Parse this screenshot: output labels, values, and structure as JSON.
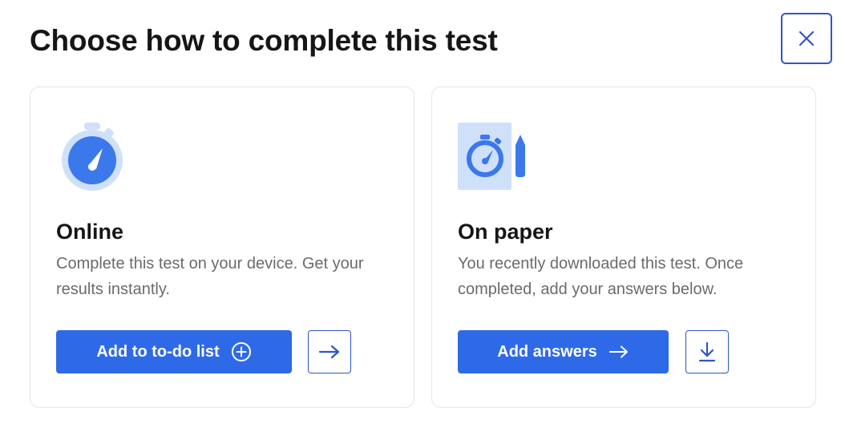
{
  "modal": {
    "title": "Choose how to complete this test",
    "close_icon": "close-icon"
  },
  "options": {
    "online": {
      "title": "Online",
      "description": "Complete this test on your device. Get your results instantly.",
      "primary_label": "Add to to-do list",
      "primary_icon": "plus-circle-icon",
      "secondary_icon": "arrow-right-icon",
      "illustration_icon": "stopwatch-icon"
    },
    "paper": {
      "title": "On paper",
      "description": "You recently downloaded this test. Once completed, add your answers below.",
      "primary_label": "Add answers",
      "primary_icon": "arrow-right-icon",
      "secondary_icon": "download-icon",
      "illustration_icon": "stopwatch-pencil-icon"
    }
  },
  "colors": {
    "accent": "#2e6ae8",
    "outline": "#2f55c8",
    "illustration_light": "#cfe0fb",
    "text_muted": "#6b6b6b"
  }
}
